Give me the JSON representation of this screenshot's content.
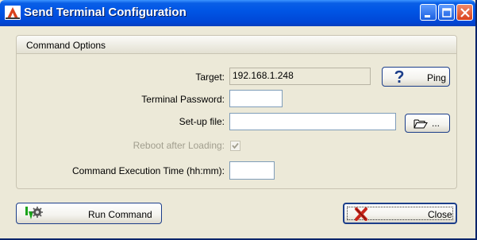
{
  "window": {
    "title": "Send Terminal Configuration",
    "icon": "send-config-icon",
    "controls": [
      "minimize-icon",
      "maximize-icon",
      "close-icon"
    ]
  },
  "group": {
    "title": "Command Options"
  },
  "form": {
    "target_label": "Target:",
    "target_value": "192.168.1.248",
    "password_label": "Terminal Password:",
    "password_value": "",
    "setup_label": "Set-up file:",
    "setup_value": "",
    "reboot_label": "Reboot after Loading:",
    "reboot_checked": true,
    "reboot_enabled": false,
    "exec_time_label": "Command Execution Time (hh:mm):",
    "exec_time_value": ""
  },
  "buttons": {
    "ping": "Ping",
    "browse": "...",
    "run": "Run Command",
    "close": "Close"
  },
  "colors": {
    "titlebar": "#0055e5",
    "face": "#ece9d8",
    "disabled_text": "#a19e8e"
  }
}
